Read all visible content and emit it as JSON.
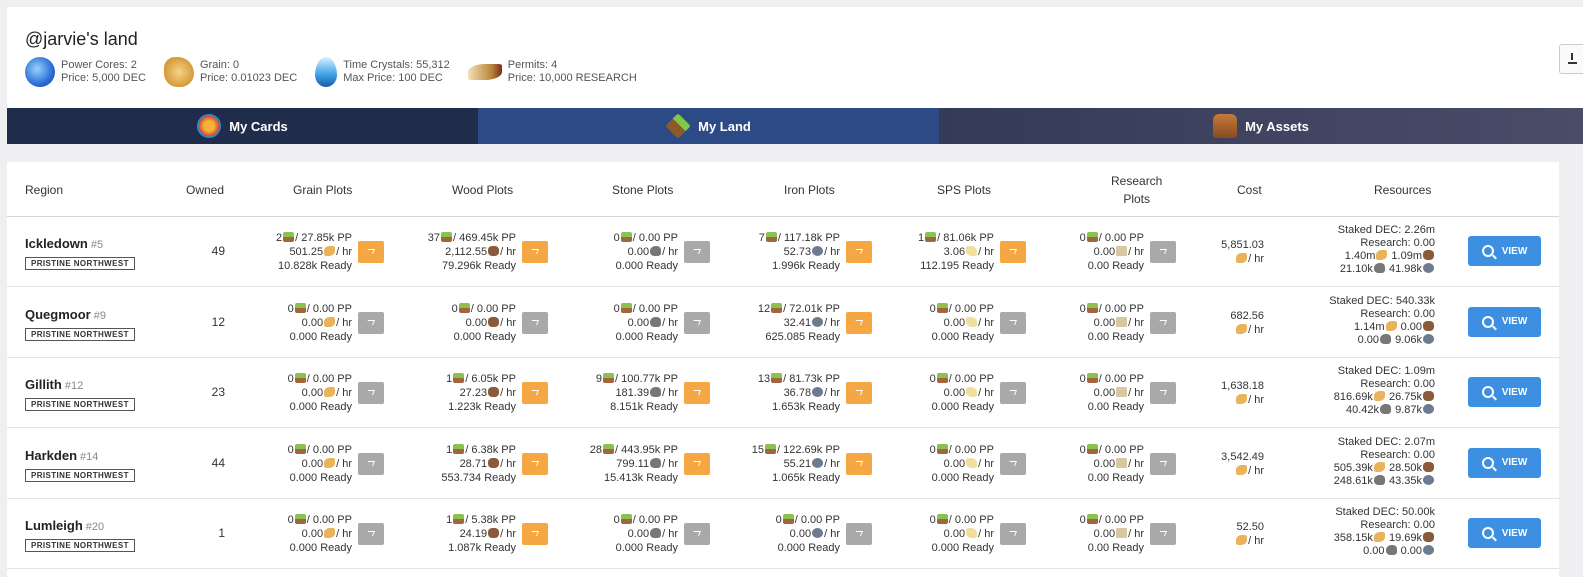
{
  "header": {
    "title": "@jarvie's land",
    "stats": [
      {
        "icon": "power-core-icon",
        "line1": "Power Cores: 2",
        "line2": "Price: 5,000 DEC"
      },
      {
        "icon": "grain-icon",
        "line1": "Grain: 0",
        "line2": "Price: 0.01023 DEC"
      },
      {
        "icon": "time-crystal-icon",
        "line1": "Time Crystals: 55,312",
        "line2": "Max Price: 100 DEC"
      },
      {
        "icon": "permit-icon",
        "line1": "Permits: 4",
        "line2": "Price: 10,000 RESEARCH"
      }
    ]
  },
  "tabs": [
    {
      "label": "My Cards",
      "icon": "cards-icon"
    },
    {
      "label": "My Land",
      "icon": "land-icon"
    },
    {
      "label": "My Assets",
      "icon": "assets-icon"
    }
  ],
  "table": {
    "headers": {
      "region": "Region",
      "owned": "Owned",
      "grain": "Grain Plots",
      "wood": "Wood Plots",
      "stone": "Stone Plots",
      "iron": "Iron Plots",
      "sps": "SPS Plots",
      "research_l1": "Research",
      "research_l2": "Plots",
      "cost": "Cost",
      "resources": "Resources"
    },
    "view_label": "VIEW",
    "rows": [
      {
        "name": "Ickledown",
        "num": "#5",
        "tag": "PRISTINE NORTHWEST",
        "owned": "49",
        "plots": [
          {
            "count": "2",
            "pp": "/ 27.85k PP",
            "rate": "501.25",
            "ready": "10.828k Ready",
            "active": true
          },
          {
            "count": "37",
            "pp": "/ 469.45k PP",
            "rate": "2,112.55",
            "ready": "79.296k Ready",
            "active": true
          },
          {
            "count": "0",
            "pp": "/ 0.00 PP",
            "rate": "0.00",
            "ready": "0.000 Ready",
            "active": false
          },
          {
            "count": "7",
            "pp": "/ 117.18k PP",
            "rate": "52.73",
            "ready": "1.996k Ready",
            "active": true
          },
          {
            "count": "1",
            "pp": "/ 81.06k PP",
            "rate": "3.06",
            "ready": "112.195 Ready",
            "active": true
          },
          {
            "count": "0",
            "pp": "/ 0.00 PP",
            "rate": "0.00",
            "ready": "0.00 Ready",
            "active": false
          }
        ],
        "cost": "5,851.03",
        "res": {
          "staked": "Staked DEC: 2.26m",
          "research": "Research: 0.00",
          "grain": "1.40m",
          "wood": "1.09m",
          "stone": "21.10k",
          "iron": "41.98k"
        }
      },
      {
        "name": "Quegmoor",
        "num": "#9",
        "tag": "PRISTINE NORTHWEST",
        "owned": "12",
        "plots": [
          {
            "count": "0",
            "pp": "/ 0.00 PP",
            "rate": "0.00",
            "ready": "0.000 Ready",
            "active": false
          },
          {
            "count": "0",
            "pp": "/ 0.00 PP",
            "rate": "0.00",
            "ready": "0.000 Ready",
            "active": false
          },
          {
            "count": "0",
            "pp": "/ 0.00 PP",
            "rate": "0.00",
            "ready": "0.000 Ready",
            "active": false
          },
          {
            "count": "12",
            "pp": "/ 72.01k PP",
            "rate": "32.41",
            "ready": "625.085 Ready",
            "active": true
          },
          {
            "count": "0",
            "pp": "/ 0.00 PP",
            "rate": "0.00",
            "ready": "0.000 Ready",
            "active": false
          },
          {
            "count": "0",
            "pp": "/ 0.00 PP",
            "rate": "0.00",
            "ready": "0.00 Ready",
            "active": false
          }
        ],
        "cost": "682.56",
        "res": {
          "staked": "Staked DEC: 540.33k",
          "research": "Research: 0.00",
          "grain": "1.14m",
          "wood": "0.00",
          "stone": "0.00",
          "iron": "9.06k"
        }
      },
      {
        "name": "Gillith",
        "num": "#12",
        "tag": "PRISTINE NORTHWEST",
        "owned": "23",
        "plots": [
          {
            "count": "0",
            "pp": "/ 0.00 PP",
            "rate": "0.00",
            "ready": "0.000 Ready",
            "active": false
          },
          {
            "count": "1",
            "pp": "/ 6.05k PP",
            "rate": "27.23",
            "ready": "1.223k Ready",
            "active": true
          },
          {
            "count": "9",
            "pp": "/ 100.77k PP",
            "rate": "181.39",
            "ready": "8.151k Ready",
            "active": true
          },
          {
            "count": "13",
            "pp": "/ 81.73k PP",
            "rate": "36.78",
            "ready": "1.653k Ready",
            "active": true
          },
          {
            "count": "0",
            "pp": "/ 0.00 PP",
            "rate": "0.00",
            "ready": "0.000 Ready",
            "active": false
          },
          {
            "count": "0",
            "pp": "/ 0.00 PP",
            "rate": "0.00",
            "ready": "0.00 Ready",
            "active": false
          }
        ],
        "cost": "1,638.18",
        "res": {
          "staked": "Staked DEC: 1.09m",
          "research": "Research: 0.00",
          "grain": "816.69k",
          "wood": "26.75k",
          "stone": "40.42k",
          "iron": "9.87k"
        }
      },
      {
        "name": "Harkden",
        "num": "#14",
        "tag": "PRISTINE NORTHWEST",
        "owned": "44",
        "plots": [
          {
            "count": "0",
            "pp": "/ 0.00 PP",
            "rate": "0.00",
            "ready": "0.000 Ready",
            "active": false
          },
          {
            "count": "1",
            "pp": "/ 6.38k PP",
            "rate": "28.71",
            "ready": "553.734 Ready",
            "active": true
          },
          {
            "count": "28",
            "pp": "/ 443.95k PP",
            "rate": "799.11",
            "ready": "15.413k Ready",
            "active": true
          },
          {
            "count": "15",
            "pp": "/ 122.69k PP",
            "rate": "55.21",
            "ready": "1.065k Ready",
            "active": true
          },
          {
            "count": "0",
            "pp": "/ 0.00 PP",
            "rate": "0.00",
            "ready": "0.000 Ready",
            "active": false
          },
          {
            "count": "0",
            "pp": "/ 0.00 PP",
            "rate": "0.00",
            "ready": "0.00 Ready",
            "active": false
          }
        ],
        "cost": "3,542.49",
        "res": {
          "staked": "Staked DEC: 2.07m",
          "research": "Research: 0.00",
          "grain": "505.39k",
          "wood": "28.50k",
          "stone": "248.61k",
          "iron": "43.35k"
        }
      },
      {
        "name": "Lumleigh",
        "num": "#20",
        "tag": "PRISTINE NORTHWEST",
        "owned": "1",
        "plots": [
          {
            "count": "0",
            "pp": "/ 0.00 PP",
            "rate": "0.00",
            "ready": "0.000 Ready",
            "active": false
          },
          {
            "count": "1",
            "pp": "/ 5.38k PP",
            "rate": "24.19",
            "ready": "1.087k Ready",
            "active": true
          },
          {
            "count": "0",
            "pp": "/ 0.00 PP",
            "rate": "0.00",
            "ready": "0.000 Ready",
            "active": false
          },
          {
            "count": "0",
            "pp": "/ 0.00 PP",
            "rate": "0.00",
            "ready": "0.000 Ready",
            "active": false
          },
          {
            "count": "0",
            "pp": "/ 0.00 PP",
            "rate": "0.00",
            "ready": "0.000 Ready",
            "active": false
          },
          {
            "count": "0",
            "pp": "/ 0.00 PP",
            "rate": "0.00",
            "ready": "0.00 Ready",
            "active": false
          }
        ],
        "cost": "52.50",
        "res": {
          "staked": "Staked DEC: 50.00k",
          "research": "Research: 0.00",
          "grain": "358.15k",
          "wood": "19.69k",
          "stone": "0.00",
          "iron": "0.00"
        }
      }
    ]
  },
  "units": {
    "per_hr": "/ hr"
  }
}
